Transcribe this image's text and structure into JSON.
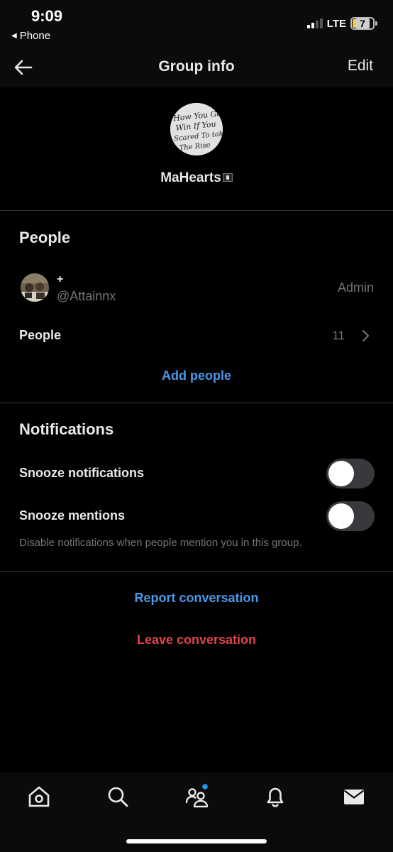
{
  "status_bar": {
    "time": "9:09",
    "back_app": "Phone",
    "network": "LTE",
    "battery": "7",
    "signal_bars": 2
  },
  "nav": {
    "title": "Group info",
    "edit_label": "Edit"
  },
  "group": {
    "name": "MaHearts",
    "avatar_text": [
      "How You Gon",
      "Win If You",
      "Scared To take",
      "The Rise"
    ]
  },
  "people": {
    "section_title": "People",
    "members": [
      {
        "name": "+",
        "handle": "@Attainnx",
        "role": "Admin"
      }
    ],
    "people_label": "People",
    "people_count": "11",
    "add_people_label": "Add people"
  },
  "notifications": {
    "section_title": "Notifications",
    "snooze_notifications_label": "Snooze notifications",
    "snooze_notifications_on": false,
    "snooze_mentions_label": "Snooze mentions",
    "snooze_mentions_on": false,
    "snooze_mentions_hint": "Disable notifications when people mention you in this group."
  },
  "actions": {
    "report_label": "Report conversation",
    "leave_label": "Leave conversation"
  },
  "tab_bar": {
    "tabs": [
      "home-icon",
      "search-icon",
      "communities-icon",
      "notifications-icon",
      "messages-icon"
    ],
    "communities_has_badge": true
  },
  "colors": {
    "accent": "#4a99e9",
    "danger": "#e0454f",
    "muted": "#71767b",
    "toggle_off": "#39393d"
  }
}
